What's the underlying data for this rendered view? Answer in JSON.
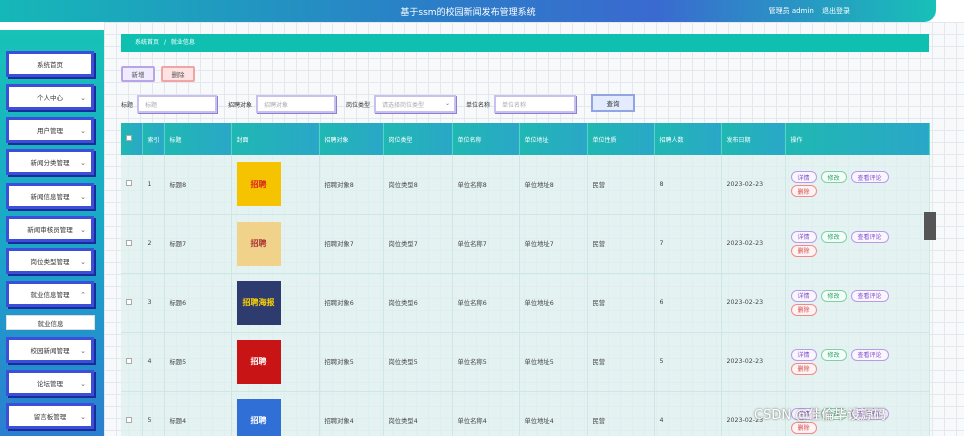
{
  "header": {
    "title": "基于ssm的校园新闻发布管理系统",
    "user_role": "管理员",
    "username": "admin",
    "logout": "退出登录"
  },
  "sidebar": {
    "items": [
      {
        "label": "系统首页",
        "chevron": ""
      },
      {
        "label": "个人中心",
        "chevron": "⌄"
      },
      {
        "label": "用户管理",
        "chevron": "⌄"
      },
      {
        "label": "新闻分类管理",
        "chevron": "⌄"
      },
      {
        "label": "新闻信息管理",
        "chevron": "⌄"
      },
      {
        "label": "新闻审核员管理",
        "chevron": "⌄"
      },
      {
        "label": "岗位类型管理",
        "chevron": "⌄"
      },
      {
        "label": "就业信息管理",
        "chevron": "⌃"
      },
      {
        "label": "校园新闻管理",
        "chevron": "⌄"
      },
      {
        "label": "论坛管理",
        "chevron": "⌄"
      },
      {
        "label": "留言板管理",
        "chevron": "⌄"
      }
    ],
    "sub_item": "就业信息"
  },
  "breadcrumb": {
    "home": "系统首页",
    "sep": "/",
    "current": "就业信息"
  },
  "toolbar": {
    "add": "新增",
    "delete": "删除"
  },
  "filters": {
    "title_label": "标题",
    "title_placeholder": "标题",
    "target_label": "招聘对象",
    "target_placeholder": "招聘对象",
    "type_label": "岗位类型",
    "type_placeholder": "请选择岗位类型",
    "company_label": "单位名称",
    "company_placeholder": "单位名称",
    "search": "查询"
  },
  "table": {
    "headers": [
      "索引",
      "标题",
      "封面",
      "招聘对象",
      "岗位类型",
      "单位名称",
      "单位地址",
      "单位性质",
      "招聘人数",
      "发布日期",
      "操作"
    ],
    "rows": [
      {
        "idx": "1",
        "title": "标题8",
        "cover": "招聘",
        "target": "招聘对象8",
        "type": "岗位类型8",
        "company": "单位名称8",
        "address": "单位地址8",
        "nature": "民营",
        "count": "8",
        "date": "2023-02-23"
      },
      {
        "idx": "2",
        "title": "标题7",
        "cover": "招聘",
        "target": "招聘对象7",
        "type": "岗位类型7",
        "company": "单位名称7",
        "address": "单位地址7",
        "nature": "民营",
        "count": "7",
        "date": "2023-02-23"
      },
      {
        "idx": "3",
        "title": "标题6",
        "cover": "招聘海报",
        "target": "招聘对象6",
        "type": "岗位类型6",
        "company": "单位名称6",
        "address": "单位地址6",
        "nature": "民营",
        "count": "6",
        "date": "2023-02-23"
      },
      {
        "idx": "4",
        "title": "标题5",
        "cover": "招聘",
        "target": "招聘对象5",
        "type": "岗位类型5",
        "company": "单位名称5",
        "address": "单位地址5",
        "nature": "民营",
        "count": "5",
        "date": "2023-02-23"
      },
      {
        "idx": "5",
        "title": "标题4",
        "cover": "招聘",
        "target": "招聘对象4",
        "type": "岗位类型4",
        "company": "单位名称4",
        "address": "单位地址4",
        "nature": "民营",
        "count": "4",
        "date": "2023-02-23"
      }
    ],
    "ops": {
      "detail": "详情",
      "edit": "修改",
      "comments": "查看评论",
      "delete": "删除"
    }
  },
  "watermark": "CSDN @佳倫毕设源码"
}
